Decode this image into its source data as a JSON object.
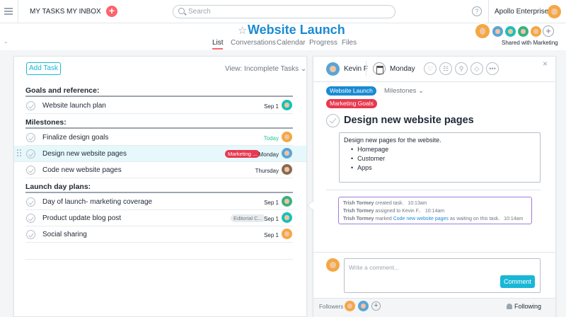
{
  "topbar": {
    "my_tasks": "MY TASKS",
    "my_inbox": "MY INBOX",
    "add_icon": "+",
    "search_placeholder": "Search",
    "help_icon": "?",
    "org_name": "Apollo Enterprise..."
  },
  "project": {
    "title": "Website Launch",
    "tabs": [
      {
        "label": "List",
        "active": true
      },
      {
        "label": "Conversations",
        "active": false
      },
      {
        "label": "Calendar",
        "active": false
      },
      {
        "label": "Progress",
        "active": false
      },
      {
        "label": "Files",
        "active": false
      }
    ],
    "add_member": "+",
    "shared_with": "Shared with Marketing"
  },
  "list": {
    "add_task": "Add Task",
    "view_filter": "View: Incomplete Tasks",
    "sections": [
      {
        "name": "Goals and reference:",
        "tasks": [
          {
            "name": "Website launch plan",
            "date": "Sep 1"
          }
        ]
      },
      {
        "name": "Milestones:",
        "tasks": [
          {
            "name": "Finalize design goals",
            "date": "Today"
          },
          {
            "name": "Design new website pages",
            "tag": "Marketing ...",
            "date": "Monday",
            "selected": true
          },
          {
            "name": "Code new website pages",
            "date": "Thursday"
          }
        ]
      },
      {
        "name": "Launch day plans:",
        "tasks": [
          {
            "name": "Day of launch- marketing coverage",
            "date": "Sep 1"
          },
          {
            "name": "Product update blog post",
            "tag": "Editorial C...",
            "date": "Sep 1"
          },
          {
            "name": "Social sharing",
            "date": "Sep 1"
          }
        ]
      }
    ]
  },
  "detail": {
    "assignee": "Kevin F",
    "due_date": "Monday",
    "project_tag": "Website Launch",
    "milestones": "Milestones",
    "tag": "Marketing Goals",
    "title": "Design new website pages",
    "description": "Design new pages for the website.",
    "bullets": [
      "Homepage",
      "Customer",
      "Apps"
    ],
    "activity": [
      {
        "who": "Trish Tormey",
        "text": " created task.",
        "time": "10:13am"
      },
      {
        "who": "Trish Tormey",
        "text": " assigned to Kevin F..",
        "time": "10:14am"
      },
      {
        "who": "Trish Tormey",
        "text": " marked ",
        "link": "Code new website pages",
        "after": " as waiting on this task.",
        "time": "10:14am"
      }
    ],
    "comment_placeholder": "Write a comment...",
    "comment_button": "Comment",
    "followers_label": "Followers",
    "following_label": "Following",
    "close_icon": "×"
  },
  "colors": {
    "accent": "#19b7d6",
    "project_blue": "#1a8bd2",
    "tag_red": "#e8384f",
    "today_green": "#25c39a",
    "activity_border": "#a07cdd"
  }
}
